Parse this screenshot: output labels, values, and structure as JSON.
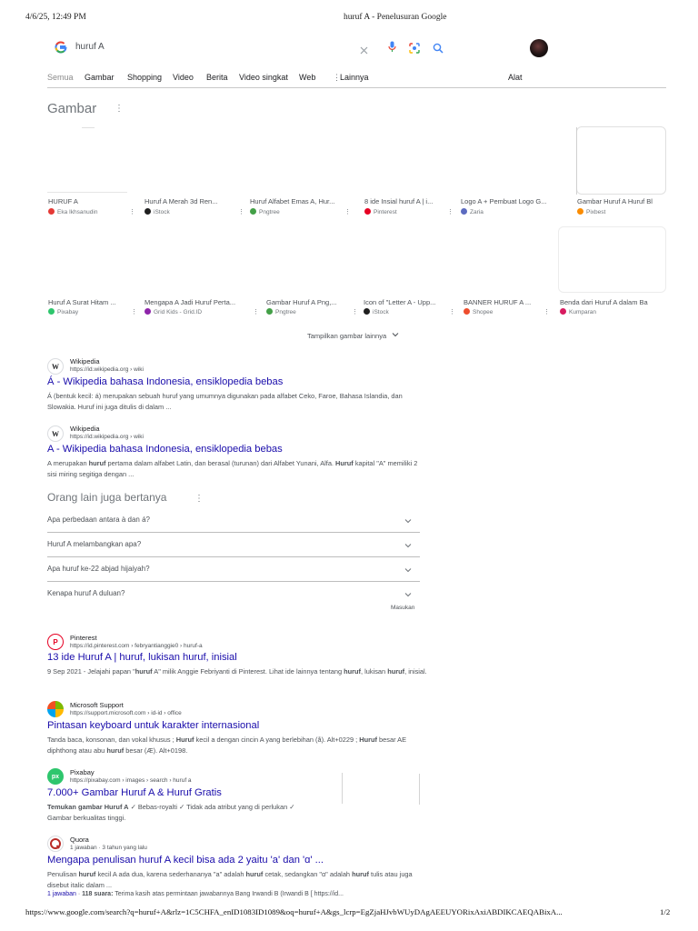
{
  "print_header": {
    "datetime": "4/6/25, 12:49 PM",
    "title": "huruf A - Penelusuran Google"
  },
  "search": {
    "query": "huruf A"
  },
  "tabs": [
    "Semua",
    "Gambar",
    "Shopping",
    "Video",
    "Berita",
    "Video singkat",
    "Web",
    "Lainnya"
  ],
  "tools_label": "Alat",
  "images_section": {
    "title": "Gambar",
    "row1": [
      {
        "caption": "HURUF A",
        "source": "Eka Ikhsanudin",
        "dot": "#e53935"
      },
      {
        "caption": "Huruf A Merah 3d Ren...",
        "source": "iStock",
        "dot": "#1f1f1f"
      },
      {
        "caption": "Huruf Alfabet Emas A, Hur...",
        "source": "Pngtree",
        "dot": "#43a047"
      },
      {
        "caption": "8 ide Insial huruf A | i...",
        "source": "Pinterest",
        "dot": "#e60023"
      },
      {
        "caption": "Logo A + Pembuat Logo G...",
        "source": "Zaria",
        "dot": "#5c6bc0"
      },
      {
        "caption": "Gambar Huruf A Huruf Bl",
        "source": "Pixbest",
        "dot": "#fb8c00"
      }
    ],
    "row2": [
      {
        "caption": "Huruf A Surat Hitam ...",
        "source": "Pixabay",
        "dot": "#2ec66d"
      },
      {
        "caption": "Mengapa A Jadi Huruf Perta...",
        "source": "Grid Kids - Grid.ID",
        "dot": "#8e24aa"
      },
      {
        "caption": "Gambar Huruf A Png,...",
        "source": "Pngtree",
        "dot": "#43a047"
      },
      {
        "caption": "Icon of \"Letter A - Upp...",
        "source": "iStock",
        "dot": "#1f1f1f"
      },
      {
        "caption": "BANNER HURUF A ...",
        "source": "Shopee",
        "dot": "#ee4d2d"
      },
      {
        "caption": "Benda dari Huruf A dalam Ba",
        "source": "Kumparan",
        "dot": "#d81b60"
      }
    ],
    "more_label": "Tampilkan gambar lainnya"
  },
  "results_top": [
    {
      "site": "Wikipedia",
      "url": "https://id.wikipedia.org › wiki",
      "favicon": "W",
      "title": "Á - Wikipedia bahasa Indonesia, ensiklopedia bebas",
      "snippet": "Á (bentuk kecil: á) merupakan sebuah huruf yang umumnya digunakan pada alfabet Ceko, Faroe, Bahasa Islandia, dan Slowakia. Huruf ini juga ditulis di dalam ..."
    },
    {
      "site": "Wikipedia",
      "url": "https://id.wikipedia.org › wiki",
      "favicon": "W",
      "title": "A - Wikipedia bahasa Indonesia, ensiklopedia bebas",
      "snippet": "A merupakan huruf pertama dalam alfabet Latin, dan berasal (turunan) dari Alfabet Yunani, Alfa. Huruf kapital \"A\" memiliki 2 sisi miring segitiga dengan ..."
    }
  ],
  "paa": {
    "title": "Orang lain juga bertanya",
    "questions": [
      "Apa perbedaan antara à dan á?",
      "Huruf A melambangkan apa?",
      "Apa huruf ke-22 abjad hijaiyah?",
      "Kenapa huruf A duluan?"
    ],
    "feedback": "Masukan"
  },
  "results_bottom": [
    {
      "site": "Pinterest",
      "url": "https://id.pinterest.com › febryantianggie0 › huruf-a",
      "favicon": "P",
      "title": "13 ide Huruf A | huruf, lukisan huruf, inisial",
      "snippet": "9 Sep 2021 - Jelajahi papan \"huruf A\" milik Anggie Febriyanti di Pinterest. Lihat ide lainnya tentang huruf, lukisan huruf, inisial."
    },
    {
      "site": "Microsoft Support",
      "url": "https://support.microsoft.com › id-id › office",
      "favicon": "MS",
      "title": "Pintasan keyboard untuk karakter internasional",
      "snippet": "Tanda baca, konsonan, dan vokal khusus ; Huruf kecil a dengan cincin A yang berlebihan (å). Alt+0229 ; Huruf besar AE diphthong atau abu huruf besar (Æ). Alt+0198."
    },
    {
      "site": "Pixabay",
      "url": "https://pixabay.com › images › search › huruf a",
      "favicon": "px",
      "title": "7.000+ Gambar Huruf A & Huruf Gratis",
      "snippet": "Temukan gambar Huruf A ✓ Bebas-royalti ✓ Tidak ada atribut yang di perlukan ✓ Gambar berkualitas tinggi."
    },
    {
      "site": "Quora",
      "url": "1 jawaban · 3 tahun yang lalu",
      "favicon": "Q",
      "title": "Mengapa penulisan huruf A kecil bisa ada 2 yaitu 'a' dan 'ɑ' ...",
      "snippet": "Penulisan huruf kecil A ada dua, karena sederhananya \"a\" adalah huruf cetak, sedangkan \"ɑ\" adalah huruf tulis atau juga disebut italic dalam ..."
    }
  ],
  "quora_meta": {
    "answers": "1 jawaban",
    "votes": "118 suara:",
    "text": "Terima kasih atas permintaan jawabannya Bang Irwandi B (Irwandi B [ https://id..."
  },
  "print_footer": {
    "url": "https://www.google.com/search?q=huruf+A&rlz=1C5CHFA_enID1083ID1089&oq=huruf+A&gs_lcrp=EgZjaHJvbWUyDAgAEEUYORixAxiABDIKCAEQABixA...",
    "page": "1/2"
  }
}
